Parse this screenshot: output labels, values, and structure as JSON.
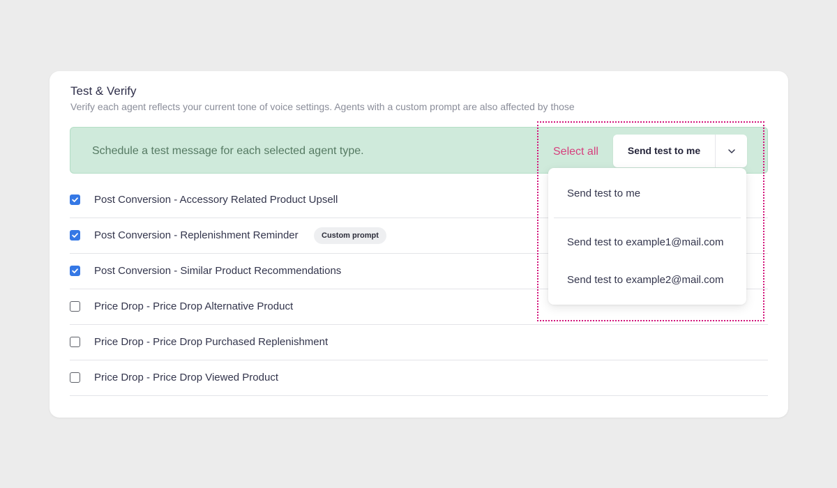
{
  "section": {
    "title": "Test & Verify",
    "subtitle": "Verify each agent reflects your current tone of voice settings. Agents with a custom prompt are also affected by those"
  },
  "banner": {
    "text": "Schedule a test message for each selected agent type.",
    "select_all_label": "Select all",
    "send_button_label": "Send test to me",
    "caret_icon": "chevron-down-icon"
  },
  "agents": [
    {
      "label": "Post Conversion - Accessory Related Product Upsell",
      "checked": true
    },
    {
      "label": "Post Conversion - Replenishment Reminder",
      "checked": true,
      "badge": "Custom prompt"
    },
    {
      "label": "Post Conversion - Similar Product Recommendations",
      "checked": true
    },
    {
      "label": "Price Drop - Price Drop Alternative Product",
      "checked": false
    },
    {
      "label": "Price Drop - Price Drop Purchased Replenishment",
      "checked": false
    },
    {
      "label": "Price Drop - Price Drop Viewed Product",
      "checked": false
    }
  ],
  "dropdown": {
    "items": [
      {
        "label": "Send test to me"
      },
      {
        "label": "Send test to example1@mail.com"
      },
      {
        "label": "Send test to example2@mail.com"
      }
    ]
  },
  "colors": {
    "page_bg": "#ececec",
    "banner_bg": "#cfeadb",
    "accent_pink": "#d63f7d",
    "checkbox_blue": "#3578e5",
    "highlight_outline": "#d2137a"
  }
}
